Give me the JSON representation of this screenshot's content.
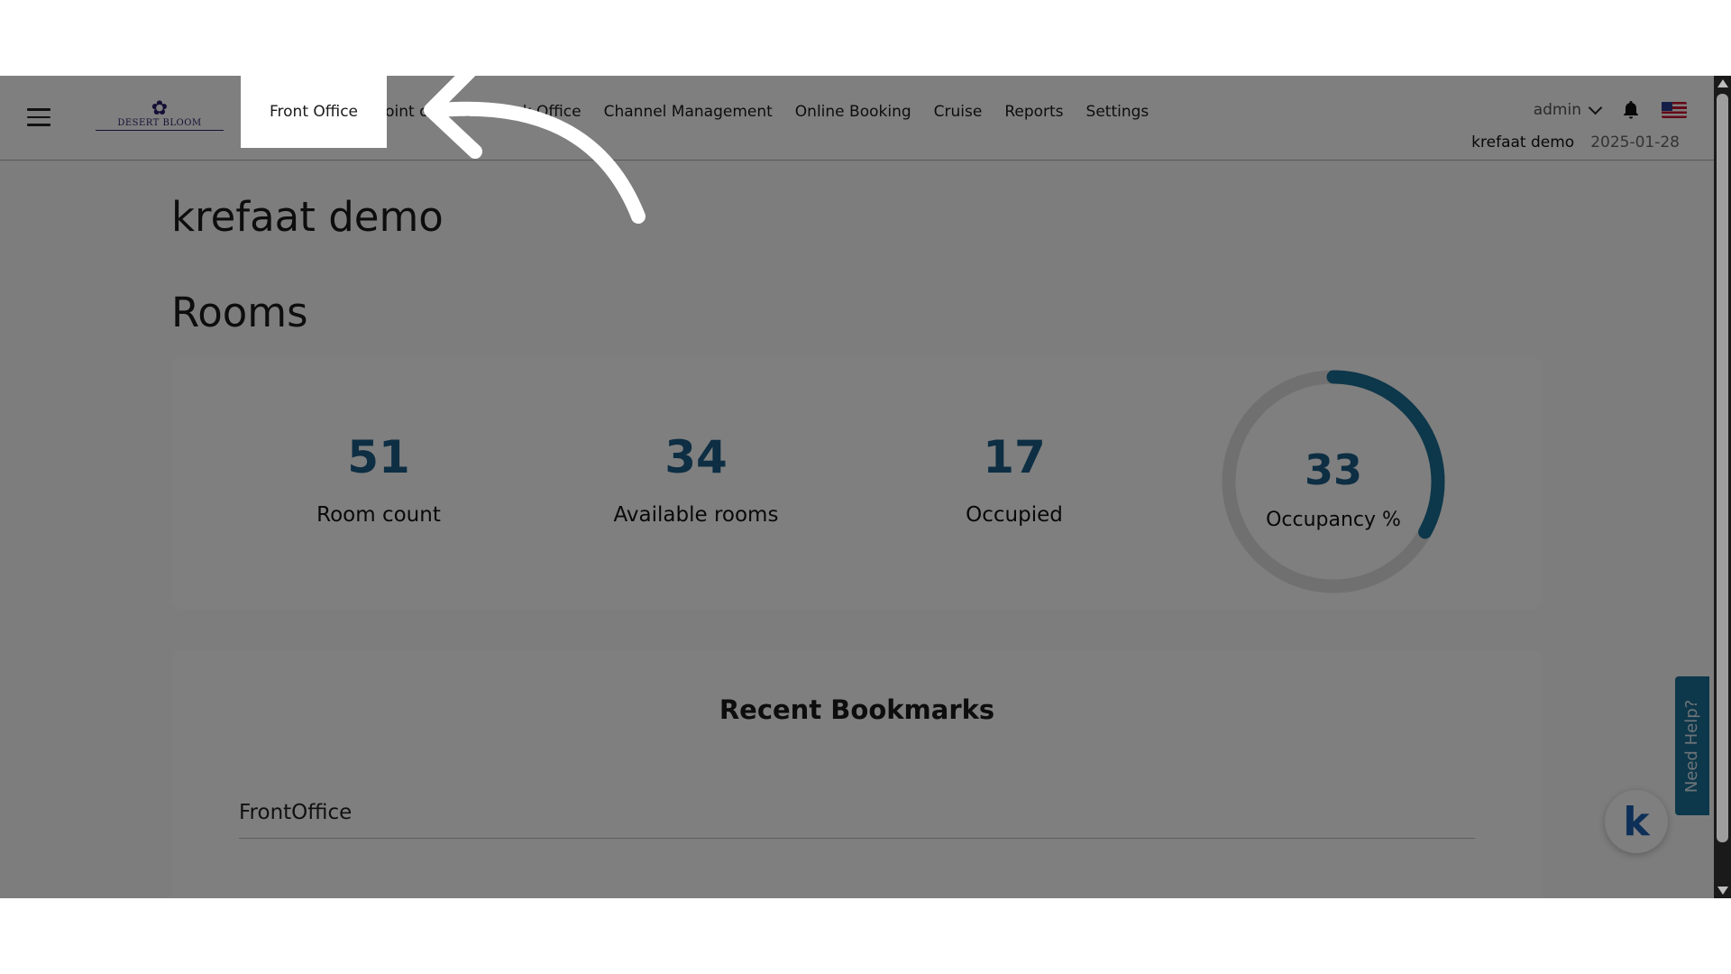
{
  "nav": {
    "logo_text": "DESERT BLOOM",
    "menu": [
      {
        "label": "Front Office",
        "active": true
      },
      {
        "label": "Point of Sale"
      },
      {
        "label": "Back Office"
      },
      {
        "label": "Channel Management"
      },
      {
        "label": "Online Booking"
      },
      {
        "label": "Cruise"
      },
      {
        "label": "Reports"
      },
      {
        "label": "Settings"
      }
    ],
    "user": "admin",
    "property": "krefaat demo",
    "date": "2025-01-28",
    "flag_icon": "us-flag-icon"
  },
  "page": {
    "title": "krefaat demo",
    "rooms_heading": "Rooms"
  },
  "rooms": {
    "room_count": "51",
    "room_count_label": "Room count",
    "available": "34",
    "available_label": "Available rooms",
    "occupied": "17",
    "occupied_label": "Occupied",
    "occupancy": "33",
    "occupancy_label": "Occupancy %",
    "occupancy_fraction": 0.33
  },
  "bookmarks": {
    "title": "Recent Bookmarks",
    "items": [
      "FrontOffice"
    ]
  },
  "help": {
    "label": "Need Help?",
    "chat_glyph": "k"
  },
  "colors": {
    "accent": "#1a5d86",
    "gauge_track": "#e0e0e0",
    "help_tab": "#1a6f95"
  }
}
